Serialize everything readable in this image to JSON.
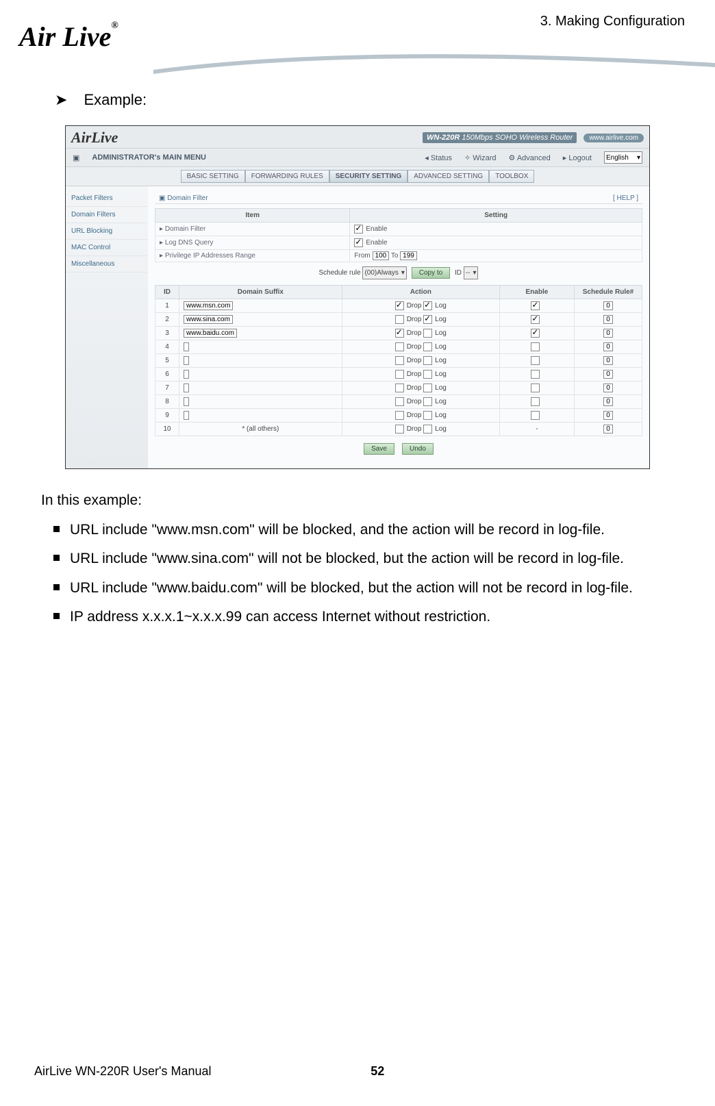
{
  "page_header": {
    "chapter": "3. Making Configuration",
    "logo_text": "Air Live",
    "logo_reg": "®"
  },
  "example_heading": "Example:",
  "shot": {
    "logo": "AirLive",
    "model": "WN-220R",
    "model_sub": "150Mbps SOHO Wireless Router",
    "url_pill": "www.airlive.com",
    "main_menu": "ADMINISTRATOR's MAIN MENU",
    "nav": {
      "status": "Status",
      "wizard": "Wizard",
      "advanced": "Advanced",
      "logout": "Logout"
    },
    "lang": "English",
    "tabs": [
      "BASIC SETTING",
      "FORWARDING RULES",
      "SECURITY SETTING",
      "ADVANCED SETTING",
      "TOOLBOX"
    ],
    "active_tab": 2,
    "sidebar": [
      "Packet Filters",
      "Domain Filters",
      "URL Blocking",
      "MAC Control",
      "Miscellaneous"
    ],
    "panel_title": "Domain Filter",
    "help": "[ HELP ]",
    "item_h": "Item",
    "setting_h": "Setting",
    "rows_top": [
      {
        "item": "Domain Filter",
        "enable": true,
        "label": "Enable"
      },
      {
        "item": "Log DNS Query",
        "enable": true,
        "label": "Enable"
      }
    ],
    "priv_row": {
      "item": "Privilege IP Addresses Range",
      "from_label": "From",
      "from": "100",
      "to_label": "To",
      "to": "199"
    },
    "sched": {
      "label": "Schedule rule",
      "value": "(00)Always",
      "copy": "Copy to",
      "id_label": "ID",
      "id_val": "--"
    },
    "grid_h": {
      "id": "ID",
      "dom": "Domain Suffix",
      "action": "Action",
      "enable": "Enable",
      "rule": "Schedule Rule#"
    },
    "rows": [
      {
        "id": "1",
        "dom": "www.msn.com",
        "drop": true,
        "log": true,
        "enable": "checked",
        "rule": "0"
      },
      {
        "id": "2",
        "dom": "www.sina.com",
        "drop": false,
        "log": true,
        "enable": "checked",
        "rule": "0"
      },
      {
        "id": "3",
        "dom": "www.baidu.com",
        "drop": true,
        "log": false,
        "enable": "checked",
        "rule": "0"
      },
      {
        "id": "4",
        "dom": "",
        "drop": false,
        "log": false,
        "enable": "",
        "rule": "0"
      },
      {
        "id": "5",
        "dom": "",
        "drop": false,
        "log": false,
        "enable": "",
        "rule": "0"
      },
      {
        "id": "6",
        "dom": "",
        "drop": false,
        "log": false,
        "enable": "",
        "rule": "0"
      },
      {
        "id": "7",
        "dom": "",
        "drop": false,
        "log": false,
        "enable": "",
        "rule": "0"
      },
      {
        "id": "8",
        "dom": "",
        "drop": false,
        "log": false,
        "enable": "",
        "rule": "0"
      },
      {
        "id": "9",
        "dom": "",
        "drop": false,
        "log": false,
        "enable": "",
        "rule": "0"
      },
      {
        "id": "10",
        "dom": "* (all others)",
        "drop": false,
        "log": false,
        "enable": "-",
        "rule": "0",
        "static": true
      }
    ],
    "drop_lbl": "Drop",
    "log_lbl": "Log",
    "save": "Save",
    "undo": "Undo"
  },
  "body": {
    "intro": "In this example:",
    "items": [
      "URL include \"www.msn.com\" will be blocked, and the action will be record in log-file.",
      "URL include \"www.sina.com\" will not be blocked, but the action will be record in log-file.",
      "URL include \"www.baidu.com\" will be blocked, but the action will not be record in log-file.",
      "IP address x.x.x.1~x.x.x.99 can access Internet without restriction."
    ]
  },
  "footer": {
    "manual": "AirLive WN-220R User's Manual",
    "page": "52"
  }
}
